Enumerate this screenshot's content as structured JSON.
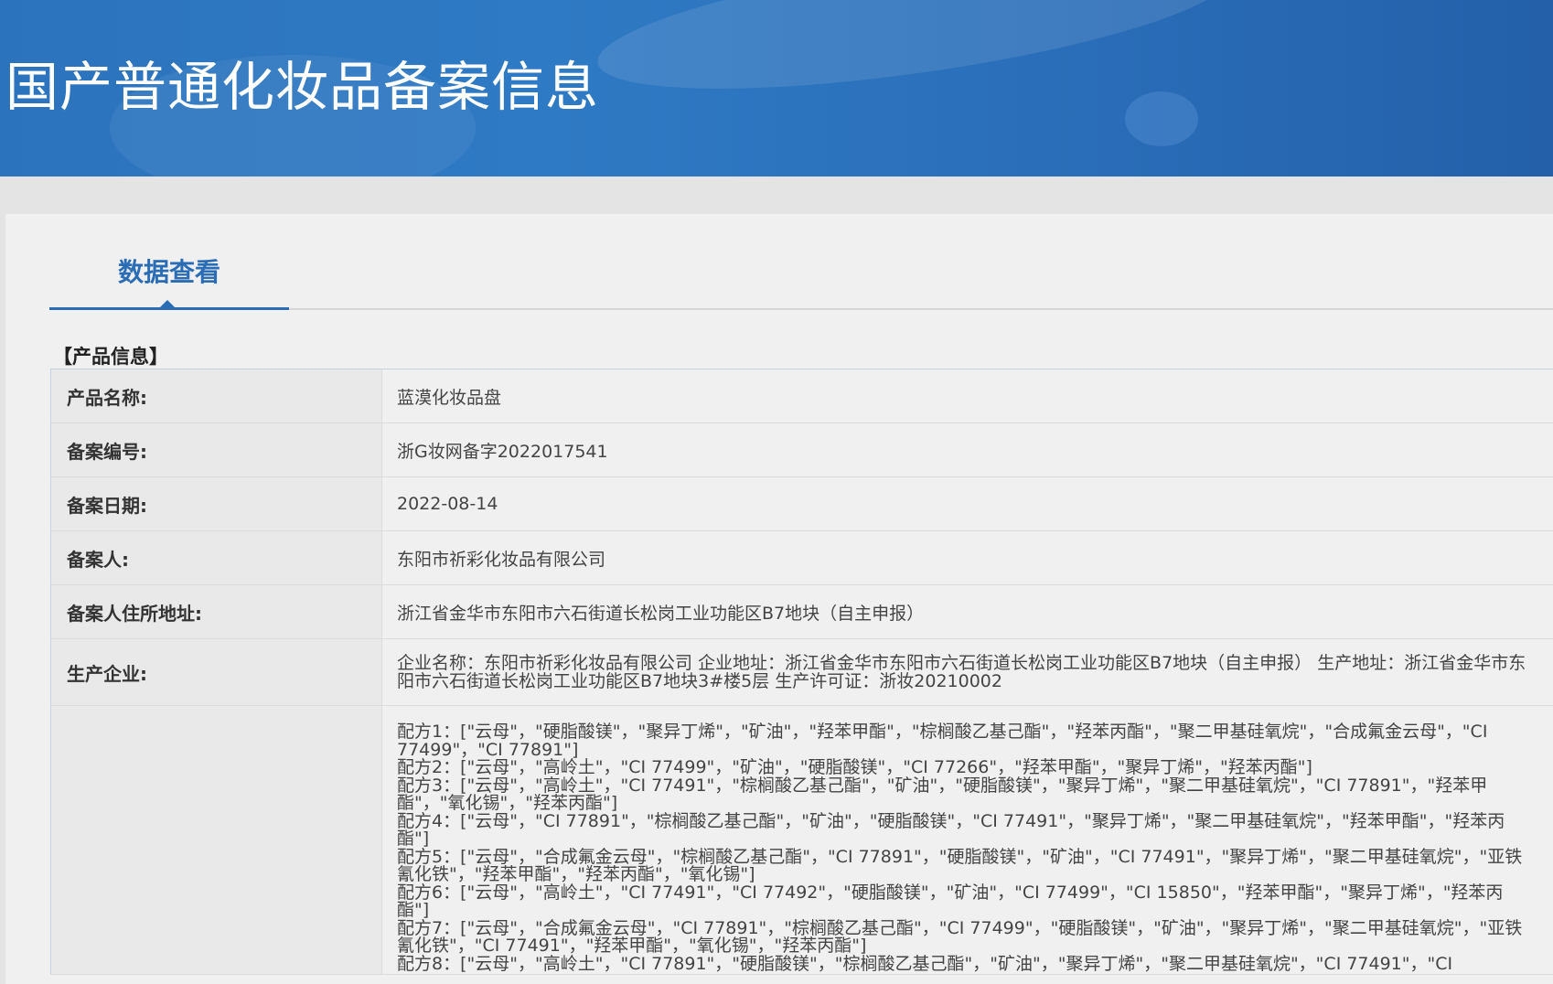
{
  "banner": {
    "title": "国产普通化妆品备案信息"
  },
  "tabs": [
    {
      "label": "数据查看"
    }
  ],
  "section": {
    "title": "【产品信息】"
  },
  "fields": {
    "product_name": {
      "label": "产品名称:",
      "value": "蓝漠化妆品盘"
    },
    "record_number": {
      "label": "备案编号:",
      "value": "浙G妆网备字2022017541"
    },
    "record_date": {
      "label": "备案日期:",
      "value": "2022-08-14"
    },
    "registrant": {
      "label": "备案人:",
      "value": "东阳市祈彩化妆品有限公司"
    },
    "registrant_address": {
      "label": "备案人住所地址:",
      "value": "浙江省金华市东阳市六石街道长松岗工业功能区B7地块（自主申报）"
    },
    "manufacturer": {
      "label": "生产企业:",
      "value": "企业名称：东阳市祈彩化妆品有限公司 企业地址：浙江省金华市东阳市六石街道长松岗工业功能区B7地块（自主申报） 生产地址：浙江省金华市东阳市六石街道长松岗工业功能区B7地块3#楼5层 生产许可证：浙妆20210002"
    },
    "formula": {
      "label": "",
      "lines": [
        "配方1：[\"云母\"，\"硬脂酸镁\"，\"聚异丁烯\"，\"矿油\"，\"羟苯甲酯\"，\"棕榈酸乙基己酯\"，\"羟苯丙酯\"，\"聚二甲基硅氧烷\"，\"合成氟金云母\"，\"CI 77499\"，\"CI 77891\"]",
        "配方2：[\"云母\"，\"高岭土\"，\"CI 77499\"，\"矿油\"，\"硬脂酸镁\"，\"CI 77266\"，\"羟苯甲酯\"，\"聚异丁烯\"，\"羟苯丙酯\"]",
        "配方3：[\"云母\"，\"高岭土\"，\"CI 77491\"，\"棕榈酸乙基己酯\"，\"矿油\"，\"硬脂酸镁\"，\"聚异丁烯\"，\"聚二甲基硅氧烷\"，\"CI 77891\"，\"羟苯甲酯\"，\"氧化锡\"，\"羟苯丙酯\"]",
        "配方4：[\"云母\"，\"CI 77891\"，\"棕榈酸乙基己酯\"，\"矿油\"，\"硬脂酸镁\"，\"CI 77491\"，\"聚异丁烯\"，\"聚二甲基硅氧烷\"，\"羟苯甲酯\"，\"羟苯丙酯\"]",
        "配方5：[\"云母\"，\"合成氟金云母\"，\"棕榈酸乙基己酯\"，\"CI 77891\"，\"硬脂酸镁\"，\"矿油\"，\"CI 77491\"，\"聚异丁烯\"，\"聚二甲基硅氧烷\"，\"亚铁氰化铁\"，\"羟苯甲酯\"，\"羟苯丙酯\"，\"氧化锡\"]",
        "配方6：[\"云母\"，\"高岭土\"，\"CI 77491\"，\"CI 77492\"，\"硬脂酸镁\"，\"矿油\"，\"CI 77499\"，\"CI 15850\"，\"羟苯甲酯\"，\"聚异丁烯\"，\"羟苯丙酯\"]",
        "配方7：[\"云母\"，\"合成氟金云母\"，\"CI 77891\"，\"棕榈酸乙基己酯\"，\"CI 77499\"，\"硬脂酸镁\"，\"矿油\"，\"聚异丁烯\"，\"聚二甲基硅氧烷\"，\"亚铁氰化铁\"，\"CI 77491\"，\"羟苯甲酯\"，\"氧化锡\"，\"羟苯丙酯\"]",
        "配方8：[\"云母\"，\"高岭土\"，\"CI 77891\"，\"硬脂酸镁\"，\"棕榈酸乙基己酯\"，\"矿油\"，\"聚异丁烯\"，\"聚二甲基硅氧烷\"，\"CI 77491\"，\"CI"
      ]
    }
  },
  "colors": {
    "banner": "#2c73bd",
    "accent": "#2a6db5",
    "page_bg": "#e4e4e4",
    "panel_bg": "#f0f0f0",
    "label_bg": "#e9e9e9"
  }
}
